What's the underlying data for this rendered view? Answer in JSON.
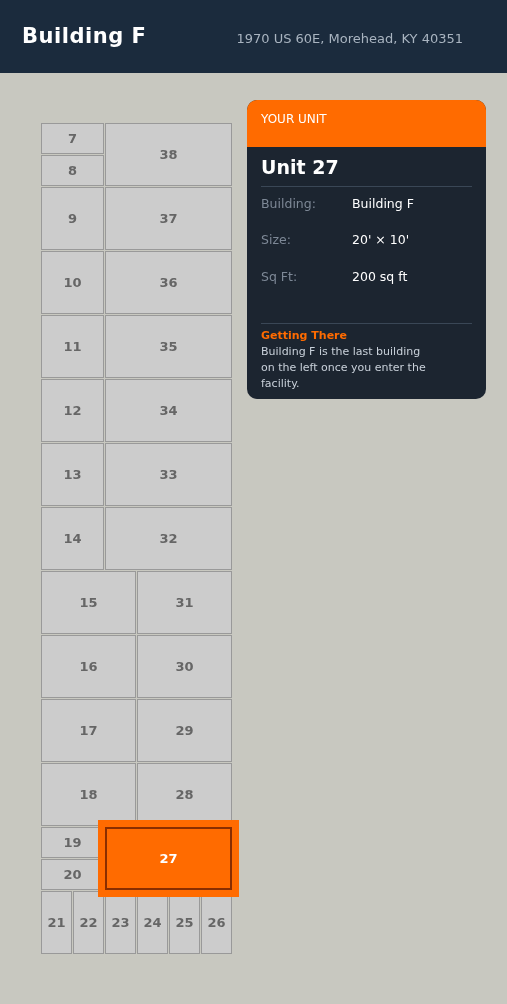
{
  "header": {
    "title": "Building F",
    "address": "1970 US 60E, Morehead, KY 40351"
  },
  "units": [
    {
      "label": "7",
      "selected": false
    },
    {
      "label": "8",
      "selected": false
    },
    {
      "label": "38",
      "selected": false
    },
    {
      "label": "9",
      "selected": false
    },
    {
      "label": "37",
      "selected": false
    },
    {
      "label": "10",
      "selected": false
    },
    {
      "label": "36",
      "selected": false
    },
    {
      "label": "11",
      "selected": false
    },
    {
      "label": "35",
      "selected": false
    },
    {
      "label": "12",
      "selected": false
    },
    {
      "label": "34",
      "selected": false
    },
    {
      "label": "13",
      "selected": false
    },
    {
      "label": "33",
      "selected": false
    },
    {
      "label": "14",
      "selected": false
    },
    {
      "label": "32",
      "selected": false
    },
    {
      "label": "15",
      "selected": false
    },
    {
      "label": "31",
      "selected": false
    },
    {
      "label": "16",
      "selected": false
    },
    {
      "label": "30",
      "selected": false
    },
    {
      "label": "17",
      "selected": false
    },
    {
      "label": "29",
      "selected": false
    },
    {
      "label": "18",
      "selected": false
    },
    {
      "label": "28",
      "selected": false
    },
    {
      "label": "19",
      "selected": false
    },
    {
      "label": "20",
      "selected": false
    },
    {
      "label": "27",
      "selected": true
    },
    {
      "label": "21",
      "selected": false
    },
    {
      "label": "22",
      "selected": false
    },
    {
      "label": "23",
      "selected": false
    },
    {
      "label": "24",
      "selected": false
    },
    {
      "label": "25",
      "selected": false
    },
    {
      "label": "26",
      "selected": false
    }
  ],
  "card": {
    "eyebrow": "YOUR UNIT",
    "title": "Unit 27",
    "details": [
      {
        "label": "Building:",
        "value": "Building F"
      },
      {
        "label": "Size:",
        "value": "20' × 10'"
      },
      {
        "label": "Sq Ft:",
        "value": "200 sq ft"
      }
    ],
    "directions": {
      "title": "Getting There",
      "text": "Building F is the last building on the left once you enter the facility."
    }
  }
}
